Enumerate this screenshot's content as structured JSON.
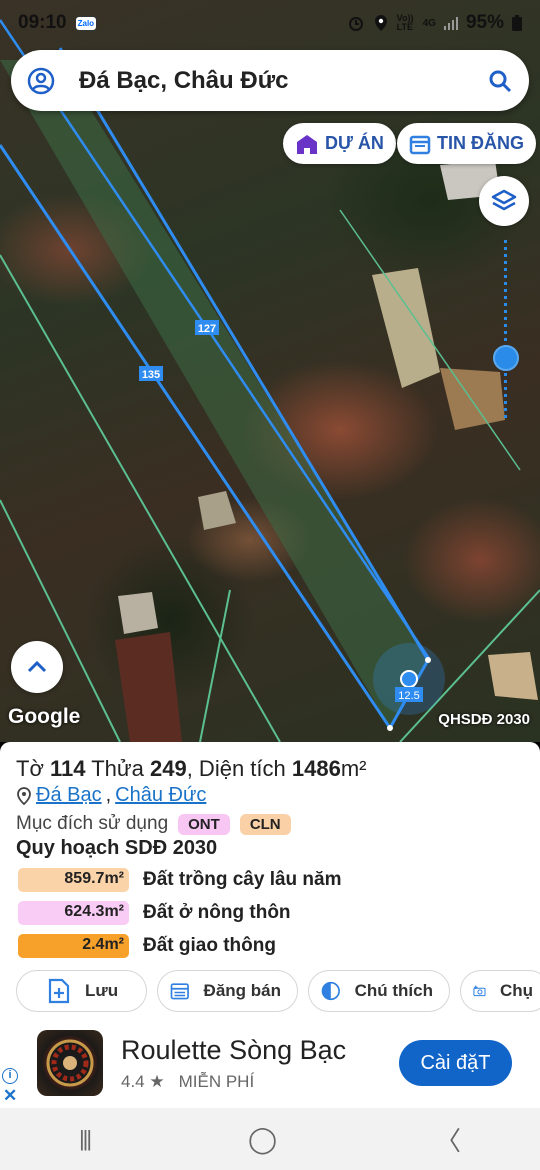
{
  "status": {
    "time": "09:10",
    "notif": "Zalo",
    "net": "Vo)) LTE",
    "gen": "4G",
    "battery": "95%"
  },
  "search": {
    "title": "Đá Bạc, Châu Đức"
  },
  "map": {
    "du_an_label": "DỰ ÁN",
    "tin_dang_label": "TIN ĐĂNG",
    "road_label_1": "127",
    "road_label_2": "135",
    "marker_label": "12.5",
    "attribution": "Google",
    "overlay_label": "QHSDĐ 2030"
  },
  "parcel": {
    "to_label": "Tờ",
    "to_value": "114",
    "thua_label": "Thửa",
    "thua_value": "249",
    "area_label": ", Diện tích",
    "area_value": "1486",
    "area_unit": "m²",
    "location_1": "Đá Bạc",
    "location_sep": ",",
    "location_2": "Châu Đức",
    "purpose_label": "Mục đích sử dụng",
    "purpose_tags": [
      {
        "code": "ONT",
        "color": "#f7c6f2"
      },
      {
        "code": "CLN",
        "color": "#fad0a6"
      }
    ],
    "plan_title": "Quy hoạch SDĐ 2030",
    "legend": [
      {
        "value": "859.7m²",
        "label": "Đất trồng cây lâu năm",
        "color": "#fbd3a8"
      },
      {
        "value": "624.3m²",
        "label": "Đất ở nông thôn",
        "color": "#f8ccf5"
      },
      {
        "value": "2.4m²",
        "label": "Đất giao thông",
        "color": "#f7a12b"
      }
    ]
  },
  "actions": {
    "save": "Lưu",
    "post": "Đăng bán",
    "legend": "Chú thích",
    "photo": "Chụ"
  },
  "ad": {
    "name": "Roulette Sòng Bạc",
    "rating": "4.4 ★",
    "price": "MIỄN PHÍ",
    "cta": "Cài đặT",
    "info": "i",
    "close": "✕"
  },
  "nav": {
    "recents": "|||",
    "home": "◯",
    "back": "〈"
  }
}
